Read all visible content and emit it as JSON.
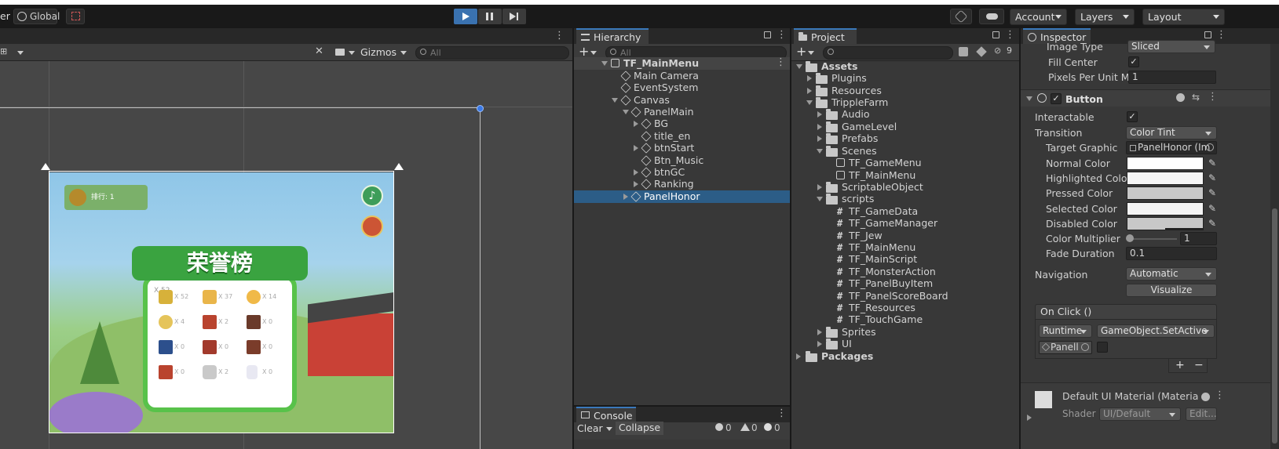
{
  "toolbar": {
    "left_partial_label": "er",
    "global_label": "Global",
    "account_label": "Account",
    "layers_label": "Layers",
    "layout_label": "Layout"
  },
  "scene": {
    "gizmos_label": "Gizmos",
    "search_placeholder": "All",
    "game_title": "荣誉榜",
    "rank_label": "排行: 1",
    "items": [
      "X 52",
      "X 37",
      "X 14",
      "X 4",
      "X 2",
      "X 0",
      "X 0",
      "X 0",
      "X 0",
      "X 0",
      "X 2",
      "X 0"
    ]
  },
  "hierarchy": {
    "tab_label": "Hierarchy",
    "search_placeholder": "All",
    "rows": [
      {
        "label": "TF_MainMenu",
        "depth": 0,
        "expanded": true,
        "kind": "scene",
        "selected": false
      },
      {
        "label": "Main Camera",
        "depth": 1,
        "kind": "go"
      },
      {
        "label": "EventSystem",
        "depth": 1,
        "kind": "go"
      },
      {
        "label": "Canvas",
        "depth": 1,
        "expanded": true,
        "kind": "go"
      },
      {
        "label": "PanelMain",
        "depth": 2,
        "expanded": true,
        "kind": "go"
      },
      {
        "label": "BG",
        "depth": 3,
        "collapsed": true,
        "kind": "go"
      },
      {
        "label": "title_en",
        "depth": 3,
        "kind": "go"
      },
      {
        "label": "btnStart",
        "depth": 3,
        "collapsed": true,
        "kind": "go"
      },
      {
        "label": "Btn_Music",
        "depth": 3,
        "kind": "go"
      },
      {
        "label": "btnGC",
        "depth": 3,
        "collapsed": true,
        "kind": "go"
      },
      {
        "label": "Ranking",
        "depth": 3,
        "collapsed": true,
        "kind": "go"
      },
      {
        "label": "PanelHonor",
        "depth": 2,
        "collapsed": true,
        "kind": "go",
        "selected": true
      }
    ]
  },
  "console": {
    "tab_label": "Console",
    "clear_label": "Clear",
    "collapse_label": "Collapse",
    "log_count": "0",
    "warn_count": "0",
    "error_count": "0"
  },
  "project": {
    "tab_label": "Project",
    "hidden_count": "9",
    "rows": [
      {
        "label": "Assets",
        "depth": 0,
        "expanded": true,
        "kind": "folder-open",
        "bold": true
      },
      {
        "label": "Plugins",
        "depth": 1,
        "kind": "folder",
        "collapsed": true
      },
      {
        "label": "Resources",
        "depth": 1,
        "kind": "folder",
        "collapsed": true
      },
      {
        "label": "TrippleFarm",
        "depth": 1,
        "kind": "folder-open",
        "expanded": true
      },
      {
        "label": "Audio",
        "depth": 2,
        "kind": "folder",
        "collapsed": true
      },
      {
        "label": "GameLevel",
        "depth": 2,
        "kind": "folder",
        "collapsed": true
      },
      {
        "label": "Prefabs",
        "depth": 2,
        "kind": "folder",
        "collapsed": true
      },
      {
        "label": "Scenes",
        "depth": 2,
        "kind": "folder-open",
        "expanded": true
      },
      {
        "label": "TF_GameMenu",
        "depth": 3,
        "kind": "scene"
      },
      {
        "label": "TF_MainMenu",
        "depth": 3,
        "kind": "scene"
      },
      {
        "label": "ScriptableObject",
        "depth": 2,
        "kind": "folder",
        "collapsed": true
      },
      {
        "label": "scripts",
        "depth": 2,
        "kind": "folder-open",
        "expanded": true
      },
      {
        "label": "TF_GameData",
        "depth": 3,
        "kind": "script"
      },
      {
        "label": "TF_GameManager",
        "depth": 3,
        "kind": "script"
      },
      {
        "label": "TF_Jew",
        "depth": 3,
        "kind": "script"
      },
      {
        "label": "TF_MainMenu",
        "depth": 3,
        "kind": "script"
      },
      {
        "label": "TF_MainScript",
        "depth": 3,
        "kind": "script"
      },
      {
        "label": "TF_MonsterAction",
        "depth": 3,
        "kind": "script"
      },
      {
        "label": "TF_PanelBuyItem",
        "depth": 3,
        "kind": "script"
      },
      {
        "label": "TF_PanelScoreBoard",
        "depth": 3,
        "kind": "script"
      },
      {
        "label": "TF_Resources",
        "depth": 3,
        "kind": "script"
      },
      {
        "label": "TF_TouchGame",
        "depth": 3,
        "kind": "script"
      },
      {
        "label": "Sprites",
        "depth": 2,
        "kind": "folder",
        "collapsed": true
      },
      {
        "label": "UI",
        "depth": 2,
        "kind": "folder",
        "collapsed": true
      },
      {
        "label": "Packages",
        "depth": 0,
        "kind": "folder",
        "collapsed": true,
        "bold": true
      }
    ]
  },
  "inspector": {
    "tab_label": "Inspector",
    "image_type_label": "Image Type",
    "image_type_value": "Sliced",
    "fill_center_label": "Fill Center",
    "fill_center_checked": "✓",
    "ppu_label": "Pixels Per Unit Mul",
    "ppu_value": "1",
    "button_header": "Button",
    "interactable_label": "Interactable",
    "interactable_checked": "✓",
    "transition_label": "Transition",
    "transition_value": "Color Tint",
    "target_graphic_label": "Target Graphic",
    "target_graphic_value": "PanelHonor (Im",
    "normal_color_label": "Normal Color",
    "highlighted_color_label": "Highlighted Color",
    "pressed_color_label": "Pressed Color",
    "selected_color_label": "Selected Color",
    "disabled_color_label": "Disabled Color",
    "color_multiplier_label": "Color Multiplier",
    "color_multiplier_value": "1",
    "fade_duration_label": "Fade Duration",
    "fade_duration_value": "0.1",
    "navigation_label": "Navigation",
    "navigation_value": "Automatic",
    "visualize_label": "Visualize",
    "onclick_header": "On Click ()",
    "runtime_value": "Runtime",
    "function_value": "GameObject.SetActive",
    "object_value": "Panell",
    "add_label": "+",
    "remove_label": "−",
    "material_label": "Default UI Material (Materia",
    "shader_label": "Shader",
    "shader_value": "UI/Default",
    "edit_label": "Edit...",
    "colors": {
      "normal": "#ffffff",
      "highlighted": "#f5f5f5",
      "pressed": "#c8c8c8",
      "selected": "#f5f5f5",
      "disabled": "#c8c8c8"
    }
  }
}
